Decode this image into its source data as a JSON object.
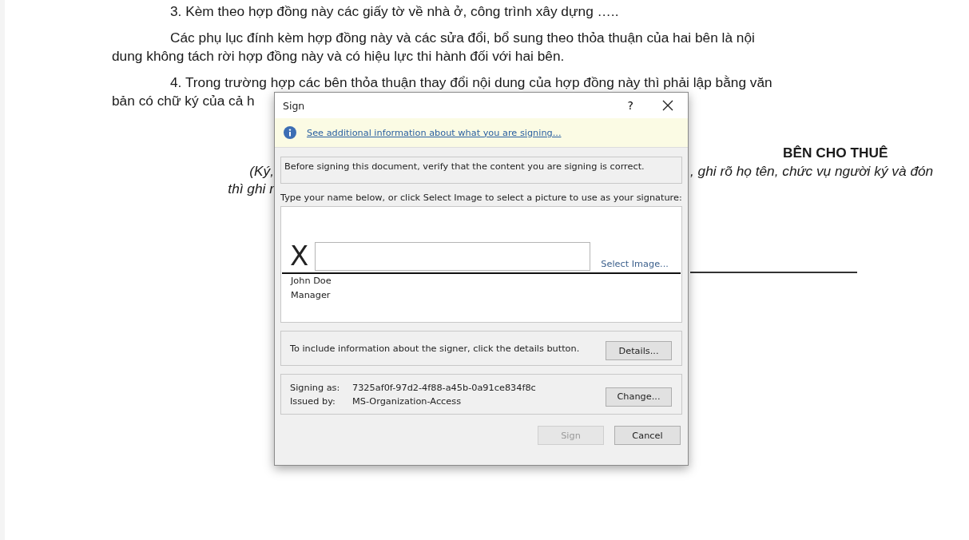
{
  "document": {
    "lines": [
      {
        "kind": "first",
        "text": "3. Kèm theo hợp đồng này các giấy tờ về nhà ở, công trình xây dựng ….."
      },
      {
        "kind": "first",
        "text": "Các phụ lục đính kèm hợp đồng này và các sửa đổi, bổ sung theo thỏa thuận của hai bên là nội"
      },
      {
        "kind": "cont",
        "text": "dung không tách rời hợp đồng này và có hiệu lực thi hành đối với hai bên."
      },
      {
        "kind": "first",
        "text": "4. Trong trường hợp các bên thỏa thuận thay đổi nội dung của hợp đồng này thì phải lập bằng văn"
      },
      {
        "kind": "cont",
        "text": "bản có chữ ký của cả h"
      }
    ],
    "signature_left": [
      "(Ký,",
      "thì ghi r"
    ],
    "signature_heading": "BÊN CHO THUÊ",
    "signature_right": ", ghi rõ họ tên, chức vụ người ký và đón"
  },
  "dialog": {
    "title": "Sign",
    "help": "?",
    "info_link": "See additional information about what you are signing...",
    "notice": "Before signing this document, verify that the content you are signing is correct.",
    "instruction": "Type your name below, or click Select Image to select a picture to use as your signature:",
    "signature": {
      "mark": "X",
      "select_image": "Select Image...",
      "signer_name": "John Doe",
      "signer_title": "Manager"
    },
    "details_text": "To include information about the signer, click the details button.",
    "details_button": "Details...",
    "signing_as_label": "Signing as:",
    "signing_as_value": "7325af0f-97d2-4f88-a45b-0a91ce834f8c",
    "issued_by_label": "Issued by:",
    "issued_by_value": "MS-Organization-Access",
    "change_button": "Change...",
    "buttons": [
      {
        "label": "Sign",
        "disabled": true
      },
      {
        "label": "Cancel",
        "disabled": false
      }
    ]
  }
}
